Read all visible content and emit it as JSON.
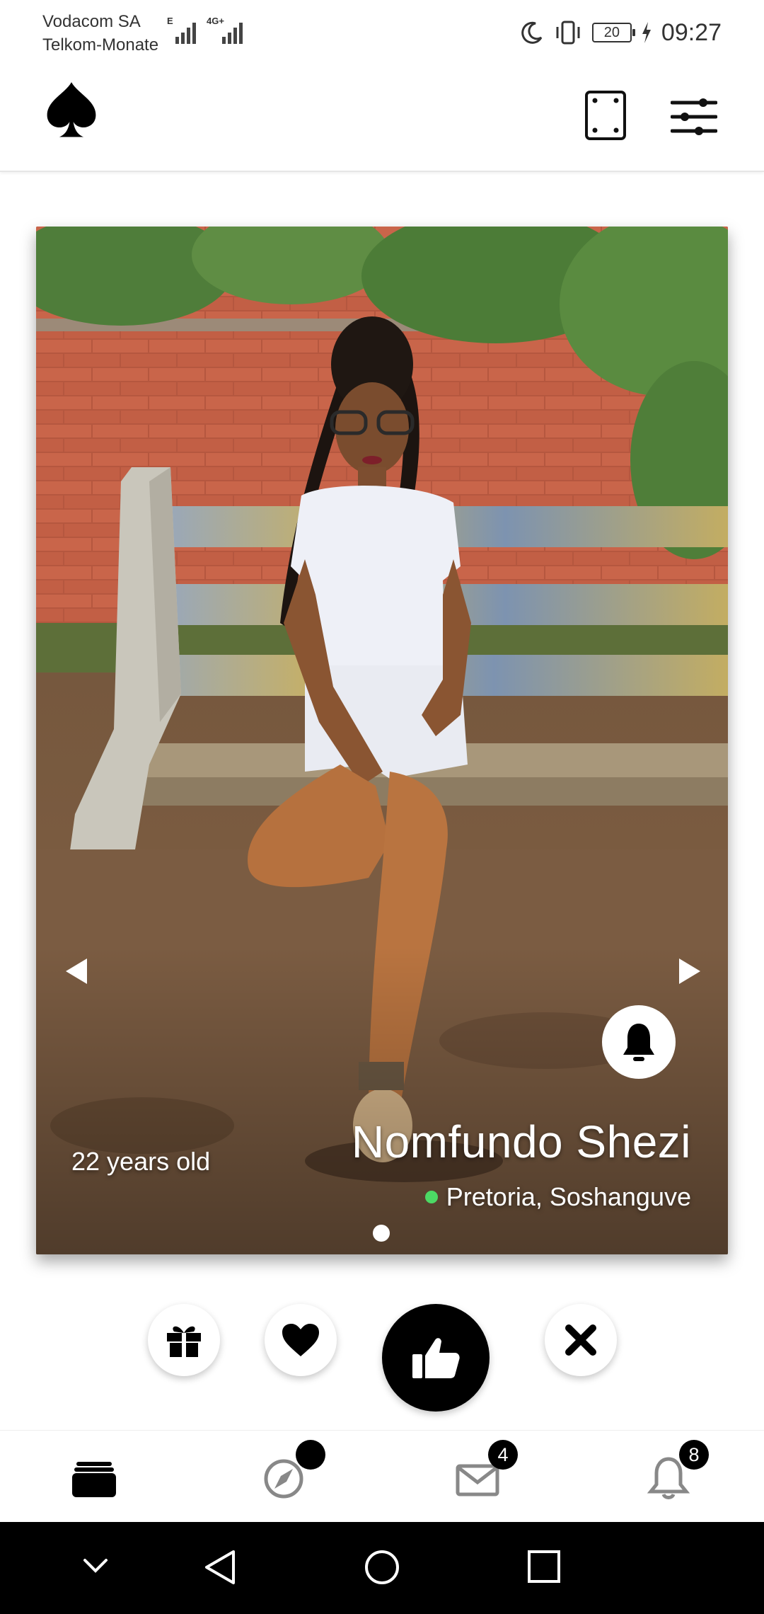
{
  "status_bar": {
    "carrier_1": "Vodacom SA",
    "carrier_2": "Telkom-Monate",
    "net_1": "E",
    "net_2": "4G+",
    "battery": "20",
    "time": "09:27"
  },
  "profile": {
    "name": "Nomfundo Shezi",
    "age": "22 years old",
    "location": "Pretoria, Soshanguve",
    "online_color": "#4cd964"
  },
  "actions": [
    "gift",
    "heart",
    "like",
    "close"
  ],
  "bottom_nav": {
    "tabs": [
      "cards",
      "explore",
      "messages",
      "notifications"
    ],
    "messages_badge": "4",
    "notifications_badge": "8"
  },
  "colors": {
    "brand": "#000000",
    "background": "#ffffff"
  }
}
